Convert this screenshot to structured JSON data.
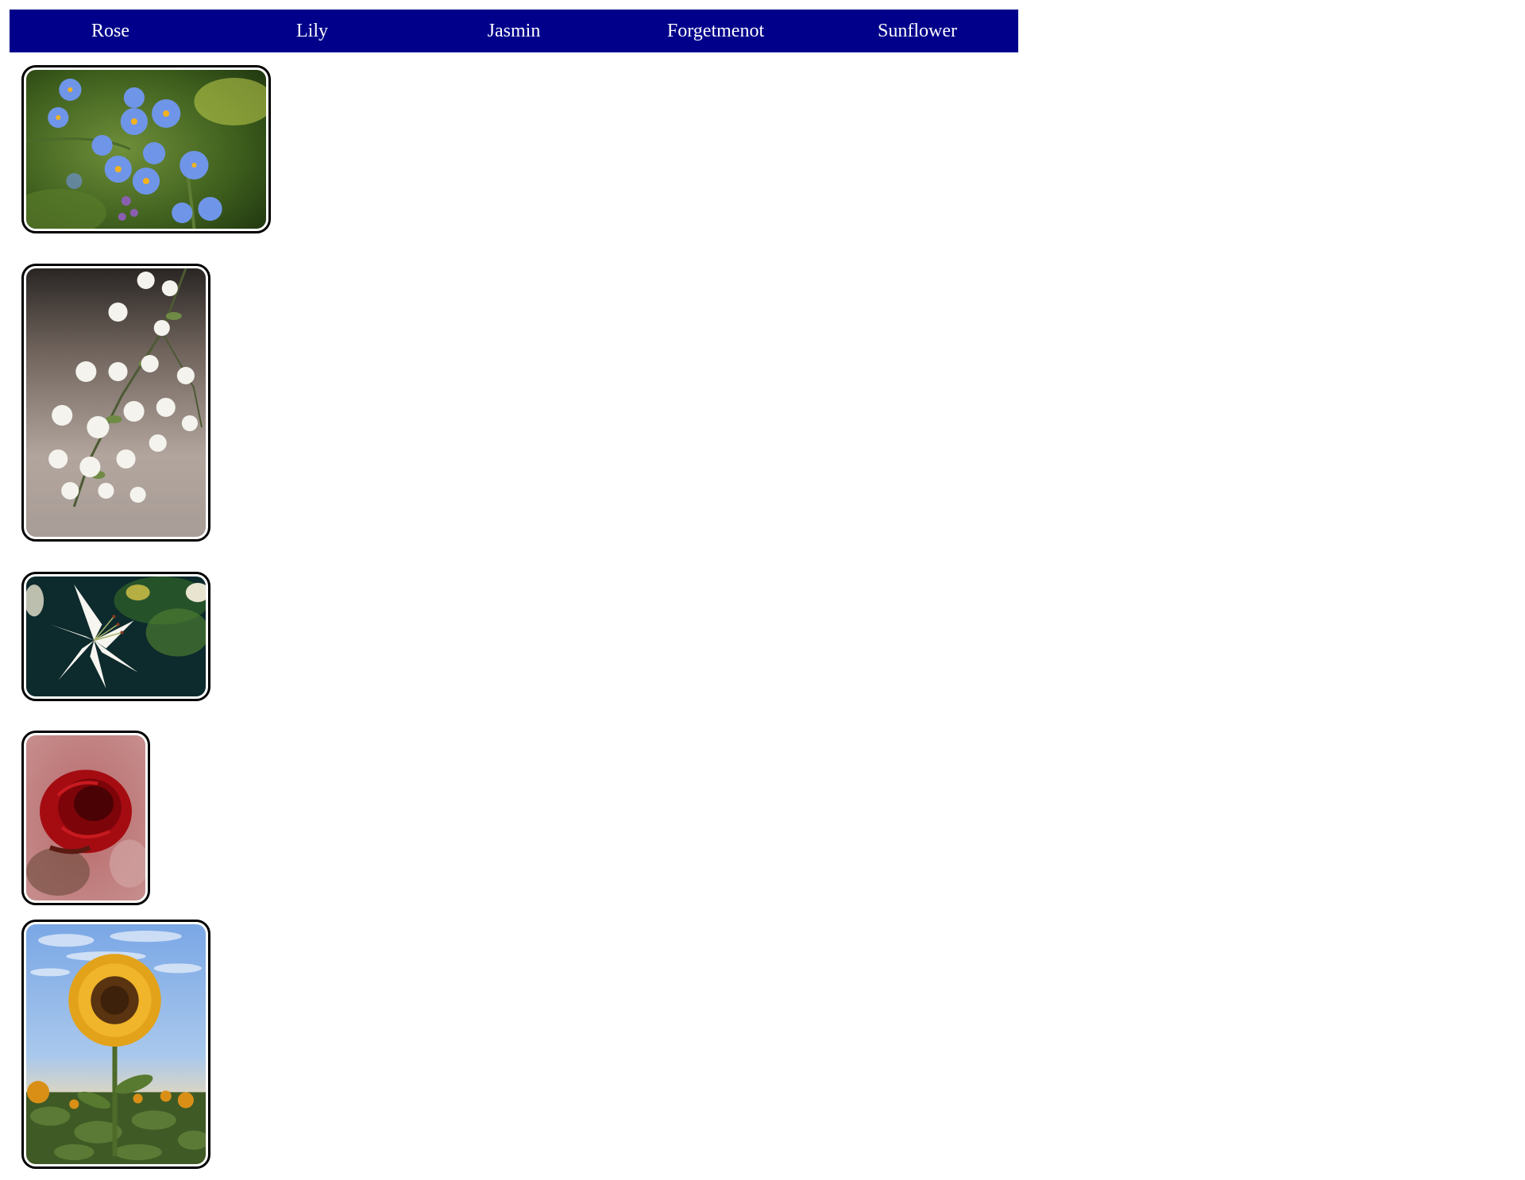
{
  "navbar": {
    "background": "#00008b",
    "items": [
      {
        "label": "Rose"
      },
      {
        "label": "Lily"
      },
      {
        "label": "Jasmin"
      },
      {
        "label": "Forgetmenot"
      },
      {
        "label": "Sunflower"
      }
    ]
  },
  "gallery": {
    "photos": [
      {
        "subject": "forget-me-not flowers"
      },
      {
        "subject": "jasmine flowers"
      },
      {
        "subject": "white lily"
      },
      {
        "subject": "red rose"
      },
      {
        "subject": "sunflower field"
      }
    ]
  }
}
